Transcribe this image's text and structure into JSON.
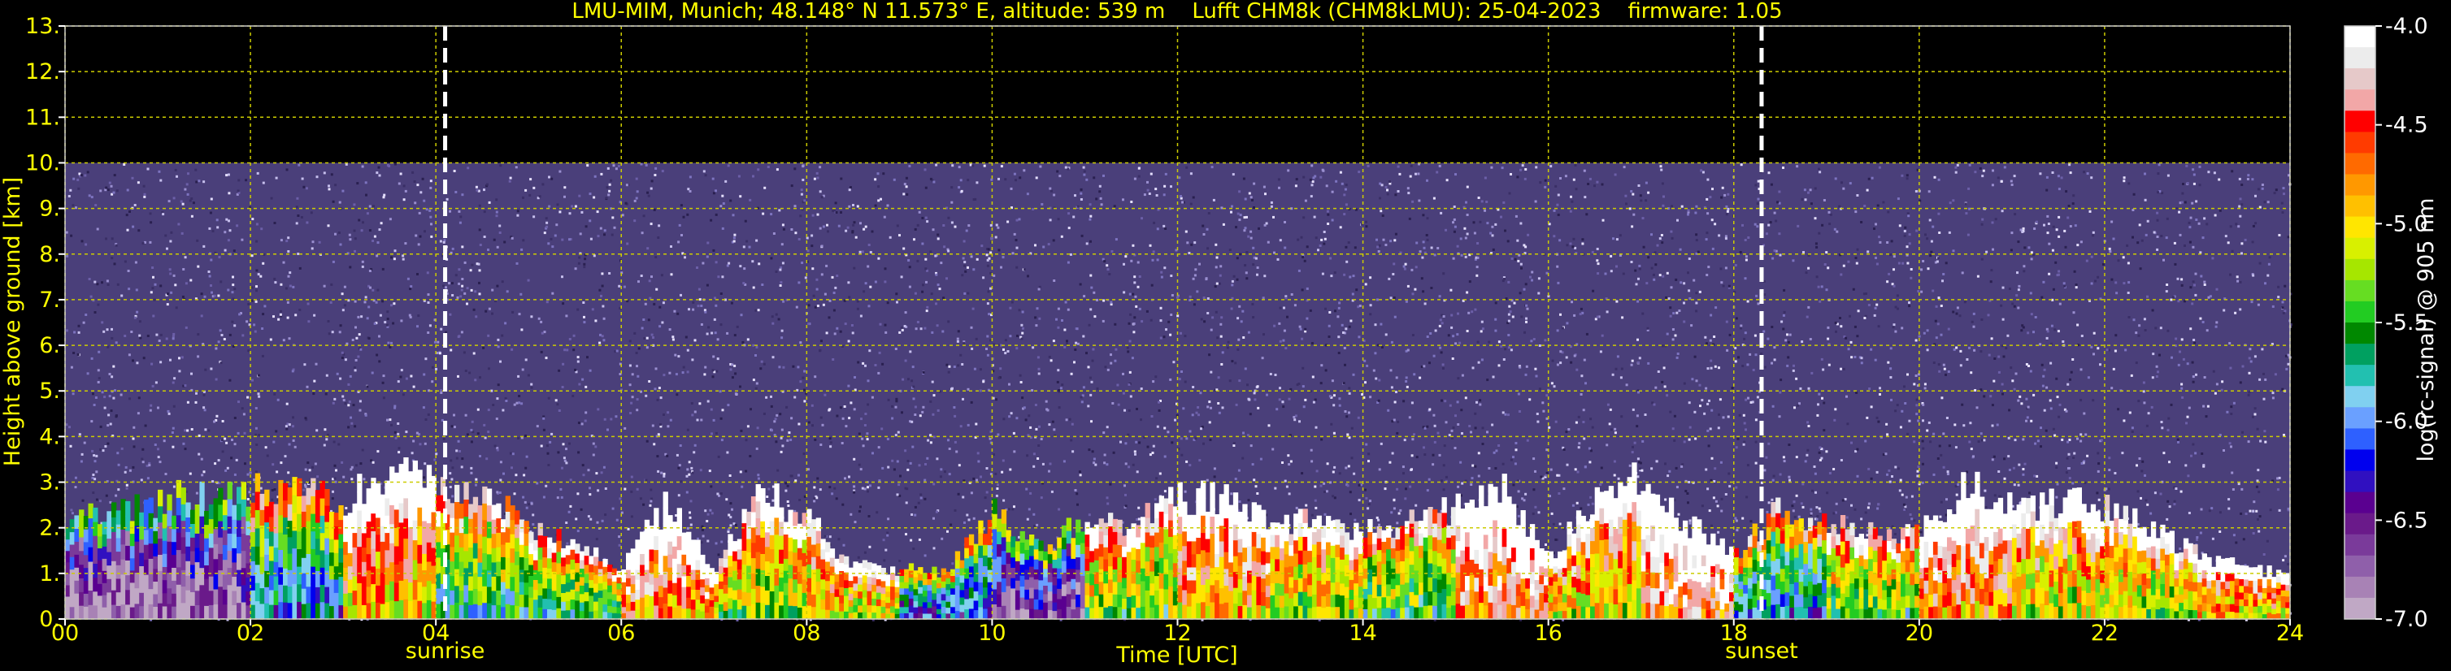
{
  "chart_data": {
    "type": "heatmap",
    "title": "LMU-MIM, Munich; 48.148° N 11.573° E, altitude: 539 m    Lufft CHM8k (CHM8kLMU): 25-04-2023    firmware: 1.05",
    "xlabel": "Time [UTC]",
    "ylabel": "Height above ground [km]",
    "xlim": [
      0,
      24
    ],
    "ylim": [
      0,
      13
    ],
    "x_tick_labels": [
      "00",
      "02",
      "04",
      "06",
      "08",
      "10",
      "12",
      "14",
      "16",
      "18",
      "20",
      "22",
      "24"
    ],
    "y_tick_labels": [
      "0.",
      "1.",
      "2.",
      "3.",
      "4.",
      "5.",
      "6.",
      "7.",
      "8.",
      "9.",
      "10.",
      "11.",
      "12.",
      "13."
    ],
    "grid": true,
    "noise_region_top_km": 10,
    "events": [
      {
        "label": "sunrise",
        "time_utc": 4.1
      },
      {
        "label": "sunset",
        "time_utc": 18.3
      }
    ],
    "colorbar": {
      "label": "log(rc-signal) @ 905 nm",
      "range": [
        -7.0,
        -4.0
      ],
      "tick_labels": [
        "-4.0",
        "-4.5",
        "-5.0",
        "-5.5",
        "-6.0",
        "-6.5",
        "-7.0"
      ],
      "colors": [
        "#ffffff",
        "#ececec",
        "#e6c9c9",
        "#f2a7a7",
        "#ff0000",
        "#ff3b00",
        "#ff6a00",
        "#ff9800",
        "#ffc000",
        "#ffe600",
        "#d8f000",
        "#a6e600",
        "#66dd22",
        "#22cc22",
        "#008800",
        "#00a060",
        "#22c0b0",
        "#80d0f0",
        "#6aa0ff",
        "#2e60ff",
        "#0000ee",
        "#3010c0",
        "#5a0090",
        "#6a1a8a",
        "#7a3a9a",
        "#8f5faa",
        "#a882b5",
        "#c0a8c5"
      ]
    },
    "layer_top_km": [
      [
        0.0,
        2.3
      ],
      [
        1.0,
        2.6
      ],
      [
        2.0,
        2.9
      ],
      [
        3.0,
        2.6
      ],
      [
        3.5,
        3.2
      ],
      [
        4.0,
        3.0
      ],
      [
        4.6,
        2.6
      ],
      [
        5.0,
        2.1
      ],
      [
        5.5,
        1.6
      ],
      [
        6.0,
        1.2
      ],
      [
        6.5,
        2.5
      ],
      [
        7.0,
        1.0
      ],
      [
        7.5,
        2.8
      ],
      [
        8.0,
        2.2
      ],
      [
        8.5,
        1.2
      ],
      [
        9.0,
        1.1
      ],
      [
        9.5,
        1.0
      ],
      [
        10.0,
        2.4
      ],
      [
        10.5,
        1.5
      ],
      [
        11.0,
        2.2
      ],
      [
        11.5,
        2.0
      ],
      [
        12.0,
        2.7
      ],
      [
        12.5,
        2.6
      ],
      [
        13.0,
        2.1
      ],
      [
        13.5,
        2.2
      ],
      [
        14.0,
        1.9
      ],
      [
        14.5,
        2.1
      ],
      [
        15.0,
        2.4
      ],
      [
        15.5,
        3.0
      ],
      [
        16.0,
        1.3
      ],
      [
        16.5,
        2.6
      ],
      [
        17.0,
        3.1
      ],
      [
        17.5,
        2.1
      ],
      [
        18.0,
        1.4
      ],
      [
        18.5,
        2.4
      ],
      [
        19.0,
        2.2
      ],
      [
        19.5,
        2.0
      ],
      [
        20.0,
        1.8
      ],
      [
        20.5,
        3.0
      ],
      [
        21.0,
        2.4
      ],
      [
        21.5,
        2.6
      ],
      [
        22.0,
        2.4
      ],
      [
        22.5,
        2.0
      ],
      [
        23.0,
        1.4
      ],
      [
        23.5,
        1.1
      ],
      [
        24.0,
        1.0
      ]
    ],
    "signal_level_by_hour": [
      -6.6,
      -6.5,
      -5.6,
      -4.6,
      -5.3,
      -5.2,
      -4.4,
      -5.0,
      -4.8,
      -5.8,
      -6.3,
      -5.0,
      -4.5,
      -4.9,
      -5.2,
      -4.3,
      -4.7,
      -4.2,
      -5.6,
      -5.1,
      -4.4,
      -4.8,
      -4.9,
      -4.6
    ]
  }
}
